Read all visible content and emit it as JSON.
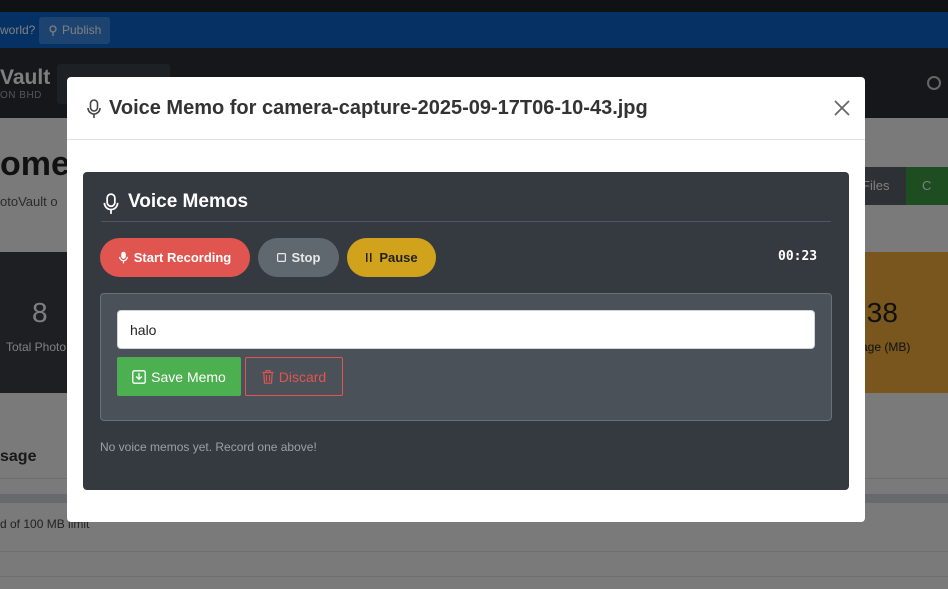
{
  "background": {
    "announce_text": "world?",
    "publish_label": "Publish",
    "brand": "Vault",
    "brand_sub": "ON BHD",
    "welcome": "ome b",
    "welcome_sub": "otoVault o",
    "files_label": "Files",
    "camera_label": "C",
    "stat_photos_value": "8",
    "stat_photos_label": "Total Photo",
    "stat_storage_value": ".38",
    "stat_storage_label": "age (MB)",
    "usage_heading": "sage",
    "usage_limit": "d of 100 MB limit"
  },
  "modal": {
    "title": "Voice Memo for camera-capture-2025-09-17T06-10-43.jpg",
    "close_icon": "close-icon"
  },
  "voice_memos": {
    "title": "Voice Memos",
    "start_label": "Start Recording",
    "stop_label": "Stop",
    "pause_label": "Pause",
    "timer": "00:23",
    "memo_input_value": "halo",
    "save_label": "Save Memo",
    "discard_label": "Discard",
    "empty_message": "No voice memos yet. Record one above!"
  },
  "colors": {
    "record": "#e0554f",
    "stop": "#5f676f",
    "pause": "#d1a21c",
    "save": "#4caf50",
    "panel": "#343a40"
  }
}
